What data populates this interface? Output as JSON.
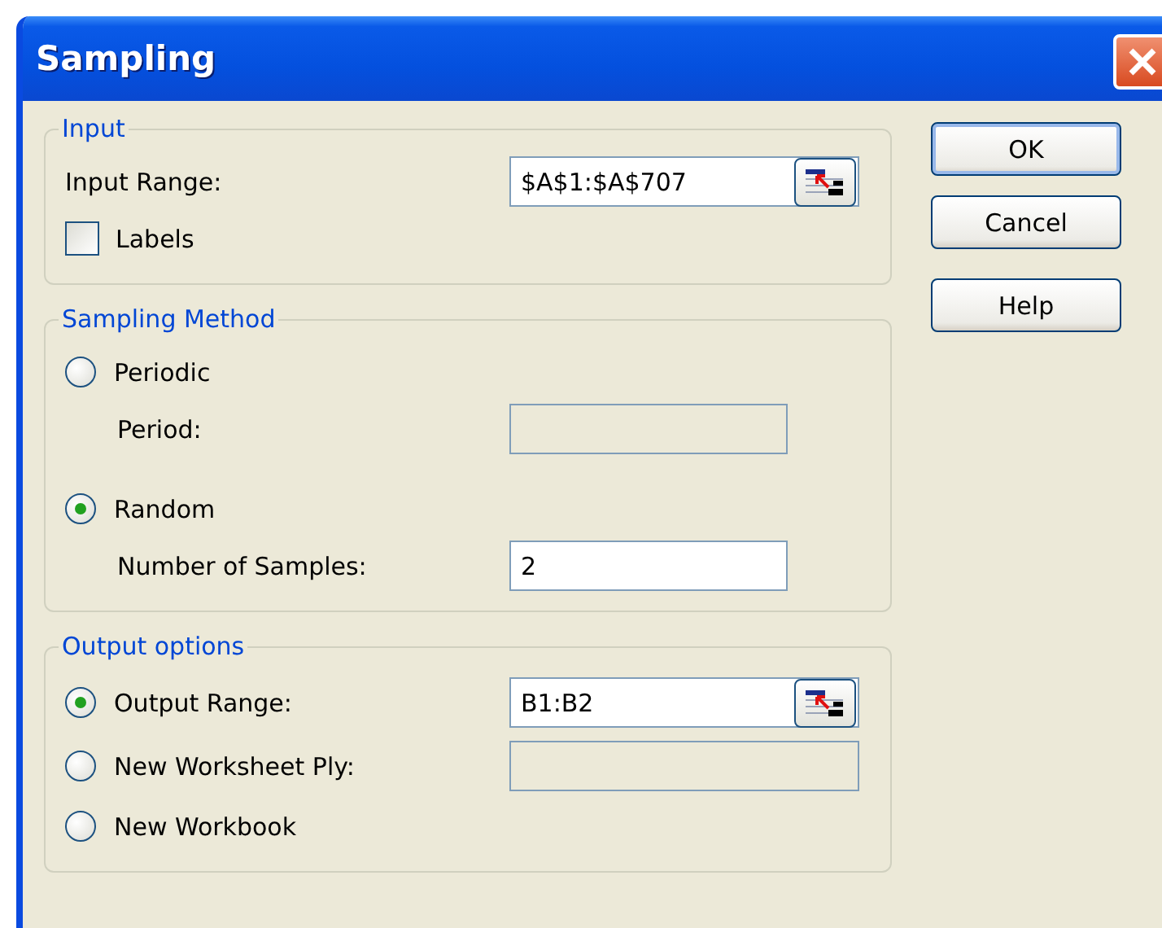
{
  "window": {
    "title": "Sampling"
  },
  "groups": [
    {
      "title": "Input",
      "rows": [
        {
          "kind": "field",
          "label": "Input Range:",
          "value": "$A$1:$A$707",
          "disabled": false,
          "indented": false,
          "range_button": true
        },
        {
          "kind": "checkbox",
          "label": "Labels",
          "checked": false
        }
      ]
    },
    {
      "title": "Sampling Method",
      "rows": [
        {
          "kind": "radio",
          "label": "Periodic",
          "selected": false
        },
        {
          "kind": "field",
          "label": "Period:",
          "disabled": true,
          "indented": true,
          "range_button": false
        },
        {
          "kind": "radio",
          "label": "Random",
          "selected": true
        },
        {
          "kind": "field",
          "label": "Number of Samples:",
          "value": "2",
          "disabled": false,
          "indented": true,
          "range_button": false
        }
      ]
    },
    {
      "title": "Output options",
      "rows": [
        {
          "kind": "radio_field",
          "label": "Output Range:",
          "selected": true,
          "value": "B1:B2",
          "disabled": false,
          "range_button": true
        },
        {
          "kind": "radio_field",
          "label": "New Worksheet Ply:",
          "selected": false,
          "disabled": true,
          "range_button": false
        },
        {
          "kind": "radio",
          "label": "New Workbook",
          "selected": false
        }
      ]
    }
  ],
  "buttons": [
    {
      "label": "OK",
      "default": true
    },
    {
      "label": "Cancel",
      "default": false
    },
    {
      "label": "Help",
      "default": false
    }
  ]
}
